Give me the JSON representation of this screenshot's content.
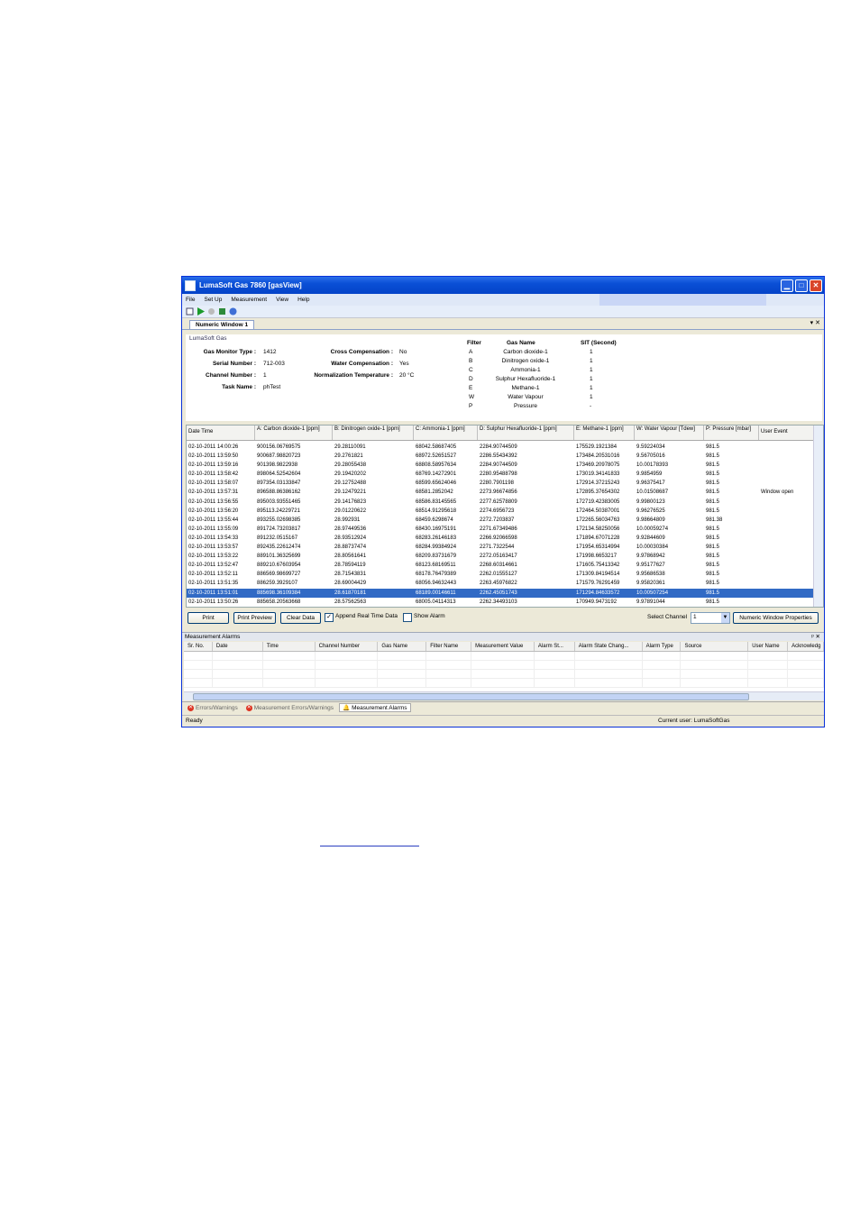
{
  "window": {
    "title": "LumaSoft Gas 7860 [gasView]"
  },
  "menu": [
    "File",
    "Set Up",
    "Measurement",
    "View",
    "Help"
  ],
  "tab": {
    "label": "Numeric Window 1",
    "controls": "▾ ✕"
  },
  "info": {
    "brand": "LumaSoft Gas",
    "gas_monitor_type_label": "Gas Monitor Type :",
    "gas_monitor_type": "1412",
    "serial_number_label": "Serial Number :",
    "serial_number": "712-003",
    "channel_number_label": "Channel Number :",
    "channel_number": "1",
    "task_name_label": "Task Name :",
    "task_name": "phTest",
    "cross_comp_label": "Cross Compensation :",
    "cross_comp": "No",
    "water_comp_label": "Water Compensation :",
    "water_comp": "Yes",
    "norm_temp_label": "Normalization Temperature :",
    "norm_temp": "20 °C"
  },
  "filters": {
    "headers": [
      "Filter",
      "Gas Name",
      "SIT (Second)"
    ],
    "rows": [
      [
        "A",
        "Carbon dioxide-1",
        "1"
      ],
      [
        "B",
        "Dinitrogen oxide-1",
        "1"
      ],
      [
        "C",
        "Ammonia-1",
        "1"
      ],
      [
        "D",
        "Sulphur Hexafluoride-1",
        "1"
      ],
      [
        "E",
        "Methane-1",
        "1"
      ],
      [
        "W",
        "Water Vapour",
        "1"
      ],
      [
        "P",
        "Pressure",
        "-"
      ]
    ]
  },
  "grid": {
    "headers": [
      "Date Time",
      "A: Carbon dioxide-1 [ppm]",
      "B: Dinitrogen oxide-1 [ppm]",
      "C: Ammonia-1 [ppm]",
      "D: Sulphur Hexafluoride-1 [ppm]",
      "E: Methane-1 [ppm]",
      "W: Water Vapour [Tdew]",
      "P: Pressure [mbar]",
      "User Event"
    ],
    "rows": [
      [
        "02-10-2011 14:00:26",
        "900156.06769575",
        "29.28110091",
        "68042.58687405",
        "2284.90744509",
        "175529.1921384",
        "9.59224034",
        "981.5",
        ""
      ],
      [
        "02-10-2011 13:59:50",
        "900687.98820723",
        "29.2761821",
        "68972.52651527",
        "2286.55434392",
        "173484.20531016",
        "9.56705016",
        "981.5",
        ""
      ],
      [
        "02-10-2011 13:59:16",
        "901398.9822938",
        "29.28055438",
        "68808.58957634",
        "2284.90744509",
        "173469.20978075",
        "10.00178393",
        "981.5",
        ""
      ],
      [
        "02-10-2011 13:58:42",
        "898064.52542604",
        "29.19420202",
        "68769.14272901",
        "2280.95488798",
        "173019.34141833",
        "9.9854959",
        "981.5",
        ""
      ],
      [
        "02-10-2011 13:58:07",
        "897354.03133847",
        "29.12752488",
        "68599.65624046",
        "2280.7901198",
        "172914.37215243",
        "9.96375417",
        "981.5",
        ""
      ],
      [
        "02-10-2011 13:57:31",
        "896588.86386162",
        "29.12479221",
        "68581.2852042",
        "2273.96674856",
        "172895.37654302",
        "10.01508687",
        "981.5",
        "Window open"
      ],
      [
        "02-10-2011 13:56:55",
        "895003.93551465",
        "29.14176823",
        "68586.83145565",
        "2277.62578809",
        "172719.42383005",
        "9.99800123",
        "981.5",
        ""
      ],
      [
        "02-10-2011 13:56:20",
        "895113.24229721",
        "29.01220622",
        "68514.91295618",
        "2274.6956723",
        "172464.50387001",
        "9.96276525",
        "981.5",
        ""
      ],
      [
        "02-10-2011 13:55:44",
        "893255.02698385",
        "28.992931",
        "68459.6298674",
        "2272.7203837",
        "172265.56034763",
        "9.98664809",
        "981.38",
        ""
      ],
      [
        "02-10-2011 13:55:09",
        "891724.73203817",
        "28.97449536",
        "68430.16975191",
        "2271.67349486",
        "172134.58250056",
        "10.00059274",
        "981.5",
        ""
      ],
      [
        "02-10-2011 13:54:33",
        "891232.0515167",
        "28.93512924",
        "68283.26146183",
        "2266.92066598",
        "171894.67071228",
        "9.92844609",
        "981.5",
        ""
      ],
      [
        "02-10-2011 13:53:57",
        "892435.22612474",
        "28.88737474",
        "68284.99384924",
        "2271.7322544",
        "171954.65314994",
        "10.00030384",
        "981.5",
        ""
      ],
      [
        "02-10-2011 13:53:22",
        "889101.36325699",
        "28.80561641",
        "68209.83731679",
        "2272.05163417",
        "171998.6653217",
        "9.97868942",
        "981.5",
        ""
      ],
      [
        "02-10-2011 13:52:47",
        "889210.67603954",
        "28.78594119",
        "68123.68169511",
        "2268.60314661",
        "171605.75413342",
        "9.95177627",
        "981.5",
        ""
      ],
      [
        "02-10-2011 13:52:11",
        "886569.98699727",
        "28.71543831",
        "68178.76479389",
        "2262.01555127",
        "171309.84194514",
        "9.95686538",
        "981.5",
        ""
      ],
      [
        "02-10-2011 13:51:35",
        "886259.3929107",
        "28.69004429",
        "68056.94632443",
        "2263.45976822",
        "171579.76291459",
        "9.95820361",
        "981.5",
        ""
      ],
      [
        "02-10-2011 13:51:01",
        "885698.36109384",
        "28.61870181",
        "68189.00146611",
        "2262.45051743",
        "171294.84633572",
        "10.00507254",
        "981.5",
        ""
      ],
      [
        "02-10-2011 13:50:26",
        "885658.20563668",
        "28.57562563",
        "68005.04114313",
        "2262.34493103",
        "170949.9473192",
        "9.97891044",
        "981.5",
        ""
      ]
    ]
  },
  "buttons": {
    "print": "Print",
    "print_preview": "Print Preview",
    "clear_data": "Clear Data",
    "append_label": "Append Real Time Data",
    "show_alarm_label": "Show Alarm",
    "select_channel_label": "Select Channel",
    "select_channel_value": "1",
    "numeric_props": "Numeric Window Properties"
  },
  "alarms": {
    "title": "Measurement Alarms",
    "controls": "ᵖ ✕",
    "headers": [
      "Sr. No.",
      "Date",
      "Time",
      "Channel Number",
      "Gas Name",
      "Filter Name",
      "Measurement Value",
      "Alarm St...",
      "Alarm State Chang...",
      "Alarm Type",
      "Source",
      "User Name",
      "Acknowledg"
    ]
  },
  "bottom_tabs": [
    "Errors/Warnings",
    "Measurement Errors/Warnings",
    "Measurement Alarms"
  ],
  "status": {
    "left": "Ready",
    "right": "Current user: LumaSoftGas"
  }
}
